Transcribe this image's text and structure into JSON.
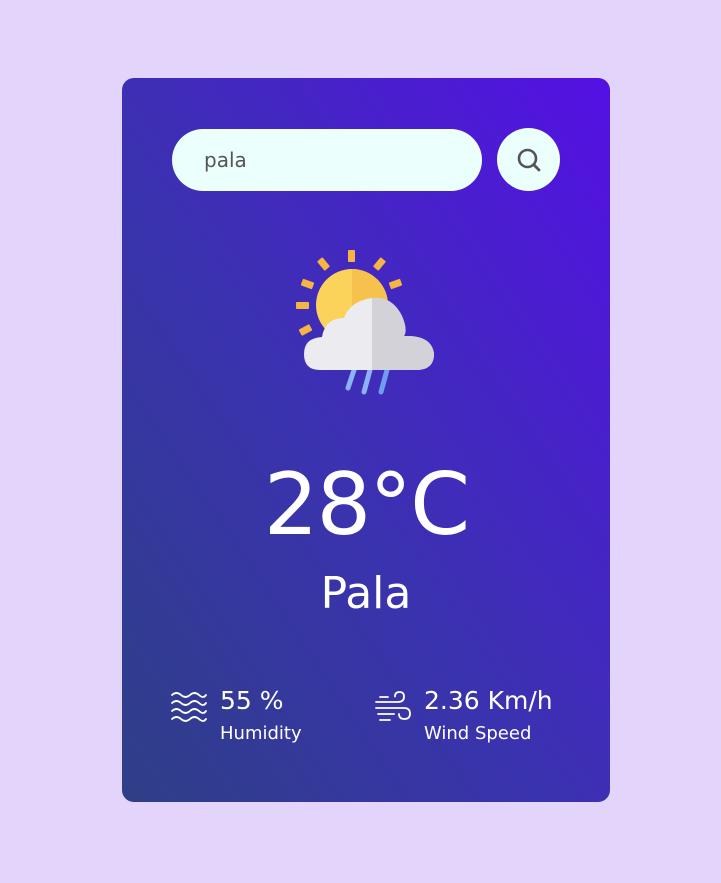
{
  "search": {
    "value": "pala"
  },
  "weather": {
    "icon": "sun-cloud-rain-icon",
    "temperature": "28°C",
    "city": "Pala"
  },
  "details": {
    "humidity": {
      "icon": "humidity-waves-icon",
      "value": "55 %",
      "label": "Humidity"
    },
    "wind": {
      "icon": "wind-icon",
      "value": "2.36 Km/h",
      "label": "Wind Speed"
    }
  },
  "colors": {
    "page_background": "#e3d4fc",
    "card_gradient_start": "#2e3f86",
    "card_gradient_end": "#5410e4",
    "input_background": "#ebfffc",
    "text": "#ffffff"
  }
}
